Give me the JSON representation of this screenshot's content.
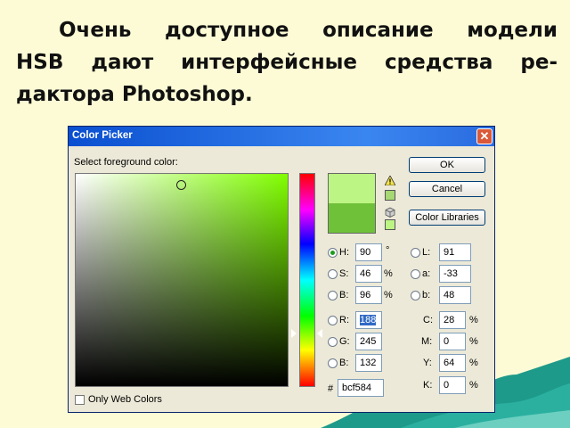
{
  "slide": {
    "line1": "Очень доступное описание модели",
    "line2": "HSB дают интерфейсные средства ре-",
    "line3": "дактора Photoshop."
  },
  "dialog": {
    "title": "Color Picker",
    "close_symbol": "✕",
    "select_label": "Select foreground color:",
    "ok_label": "OK",
    "cancel_label": "Cancel",
    "libraries_label": "Color Libraries",
    "only_web_label": "Only Web Colors",
    "hash": "#",
    "hex": "bcf584",
    "new_color": "#bcf584",
    "current_color": "#6fc13a",
    "hsb": [
      {
        "label": "H:",
        "value": "90",
        "unit": "°",
        "checked": true
      },
      {
        "label": "S:",
        "value": "46",
        "unit": "%",
        "checked": false
      },
      {
        "label": "B:",
        "value": "96",
        "unit": "%",
        "checked": false
      }
    ],
    "rgb": [
      {
        "label": "R:",
        "value": "188",
        "checked": false
      },
      {
        "label": "G:",
        "value": "245",
        "checked": false
      },
      {
        "label": "B:",
        "value": "132",
        "checked": false
      }
    ],
    "lab": [
      {
        "label": "L:",
        "value": "91"
      },
      {
        "label": "a:",
        "value": "-33"
      },
      {
        "label": "b:",
        "value": "48"
      }
    ],
    "cmyk": [
      {
        "label": "C:",
        "value": "28",
        "unit": "%"
      },
      {
        "label": "M:",
        "value": "0",
        "unit": "%"
      },
      {
        "label": "Y:",
        "value": "64",
        "unit": "%"
      },
      {
        "label": "K:",
        "value": "0",
        "unit": "%"
      }
    ]
  }
}
